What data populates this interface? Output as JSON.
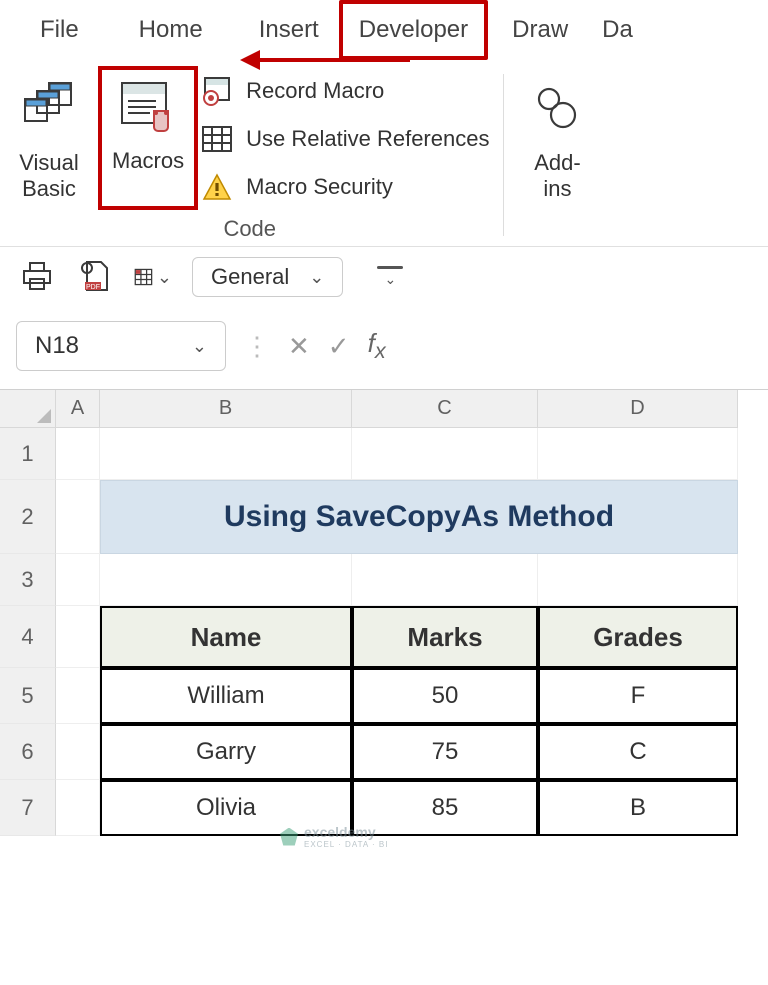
{
  "tabs": {
    "file": "File",
    "home": "Home",
    "insert": "Insert",
    "developer": "Developer",
    "draw": "Draw",
    "data": "Da"
  },
  "ribbon": {
    "visual_basic": "Visual\nBasic",
    "visual_basic_l1": "Visual",
    "visual_basic_l2": "Basic",
    "macros": "Macros",
    "record_macro": "Record Macro",
    "use_relative": "Use Relative References",
    "macro_security": "Macro Security",
    "code_group": "Code",
    "addins_l1": "Add-",
    "addins_l2": "ins"
  },
  "qat": {
    "number_format": "General"
  },
  "formula_bar": {
    "name_box": "N18"
  },
  "sheet": {
    "col_headers": [
      "A",
      "B",
      "C",
      "D"
    ],
    "row_headers": [
      "1",
      "2",
      "3",
      "4",
      "5",
      "6",
      "7"
    ],
    "title": "Using SaveCopyAs Method",
    "table": {
      "headers": [
        "Name",
        "Marks",
        "Grades"
      ],
      "rows": [
        [
          "William",
          "50",
          "F"
        ],
        [
          "Garry",
          "75",
          "C"
        ],
        [
          "Olivia",
          "85",
          "B"
        ]
      ]
    }
  },
  "watermark": {
    "brand": "exceldemy",
    "tagline": "EXCEL · DATA · BI"
  }
}
